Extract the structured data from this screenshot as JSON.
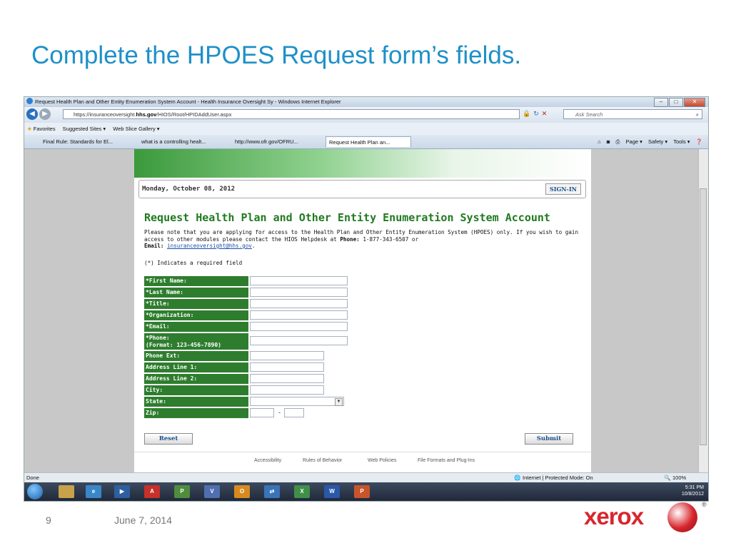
{
  "slide": {
    "title": "Complete the HPOES Request form’s fields.",
    "number": "9",
    "date": "June 7, 2014",
    "logo_text": "xerox",
    "reg_mark": "®"
  },
  "browser": {
    "window_title": "Request Health Plan and Other Entity Enumeration System Account - Health Insurance Oversight Sy - Windows Internet Explorer",
    "url_prefix": "https://insuranceoversight.",
    "url_domain": "hhs.gov",
    "url_path": "/HIOS/Root/HPIDAddUser.aspx",
    "search_placeholder": "Ask Search",
    "favorites_label": "Favorites",
    "favorites": [
      "Suggested Sites ▾",
      "Web Slice Gallery ▾"
    ],
    "tabs": [
      "Final Rule: Standards for El...",
      "what is a controlling healt...",
      "http://www.ofr.gov/OFRU...",
      "Request Health Plan an..."
    ],
    "commands": [
      "Page ▾",
      "Safety ▾",
      "Tools ▾"
    ],
    "status_left": "Done",
    "status_zone": "Internet | Protected Mode: On",
    "zoom": "100%"
  },
  "page": {
    "date": "Monday, October 08, 2012",
    "signin_label": "SIGN-IN",
    "heading": "Request Health Plan and Other Entity Enumeration System Account",
    "notice_text": "Please note that you are applying for access to the Health Plan and Other Entity Enumeration System (HPOES) only. If you wish to gain access to other modules please contact the HIOS Helpdesk at ",
    "phone_label": "Phone:",
    "phone_value": " 1-877-343-6507 or",
    "email_label": "Email:",
    "email_value": "insuranceoversight@hhs.gov",
    "required_note": "(*) Indicates a required field",
    "fields": {
      "first_name": "*First Name:",
      "last_name": "*Last Name:",
      "title": "*Title:",
      "organization": "*Organization:",
      "email": "*Email:",
      "phone_line1": "*Phone:",
      "phone_line2": "(Format: 123-456-7890)",
      "phone_ext": "Phone Ext:",
      "address1": "Address Line 1:",
      "address2": "Address Line 2:",
      "city": "City:",
      "state": "State:",
      "zip": "Zip:",
      "zip_separator": "-"
    },
    "reset_label": "Reset",
    "submit_label": "Submit",
    "footer_links": [
      "Accessibility",
      "Rules of Behavior",
      "Web Policies",
      "File Formats and Plug-Ins"
    ]
  },
  "taskbar": {
    "time": "5:31 PM",
    "date": "10/8/2012"
  }
}
